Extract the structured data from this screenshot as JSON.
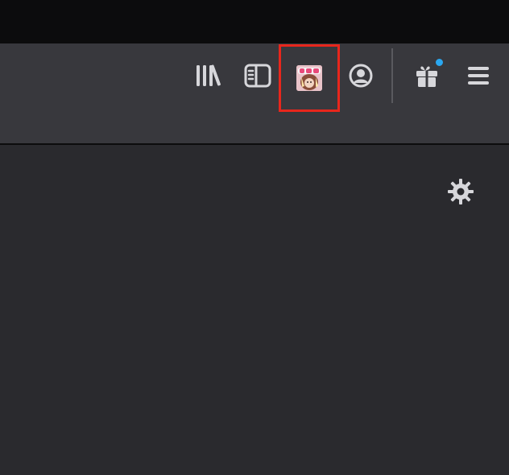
{
  "toolbar": {
    "buttons": [
      {
        "name": "library",
        "icon": "library-icon"
      },
      {
        "name": "sidebar",
        "icon": "sidebar-icon"
      },
      {
        "name": "extension",
        "icon": "extension-thumbnail-icon",
        "highlighted": true
      },
      {
        "name": "account",
        "icon": "account-icon"
      },
      {
        "name": "whats-new",
        "icon": "gift-icon",
        "badge": true
      },
      {
        "name": "menu",
        "icon": "hamburger-menu-icon"
      }
    ],
    "highlight_color": "#e8261c",
    "badge_color": "#2aa7f0"
  },
  "content": {
    "settings_icon": "gear-icon"
  },
  "colors": {
    "titlebar": "#0c0c0d",
    "toolbar": "#38383d",
    "content": "#2a2a2e",
    "icon": "#f9f9fa"
  }
}
